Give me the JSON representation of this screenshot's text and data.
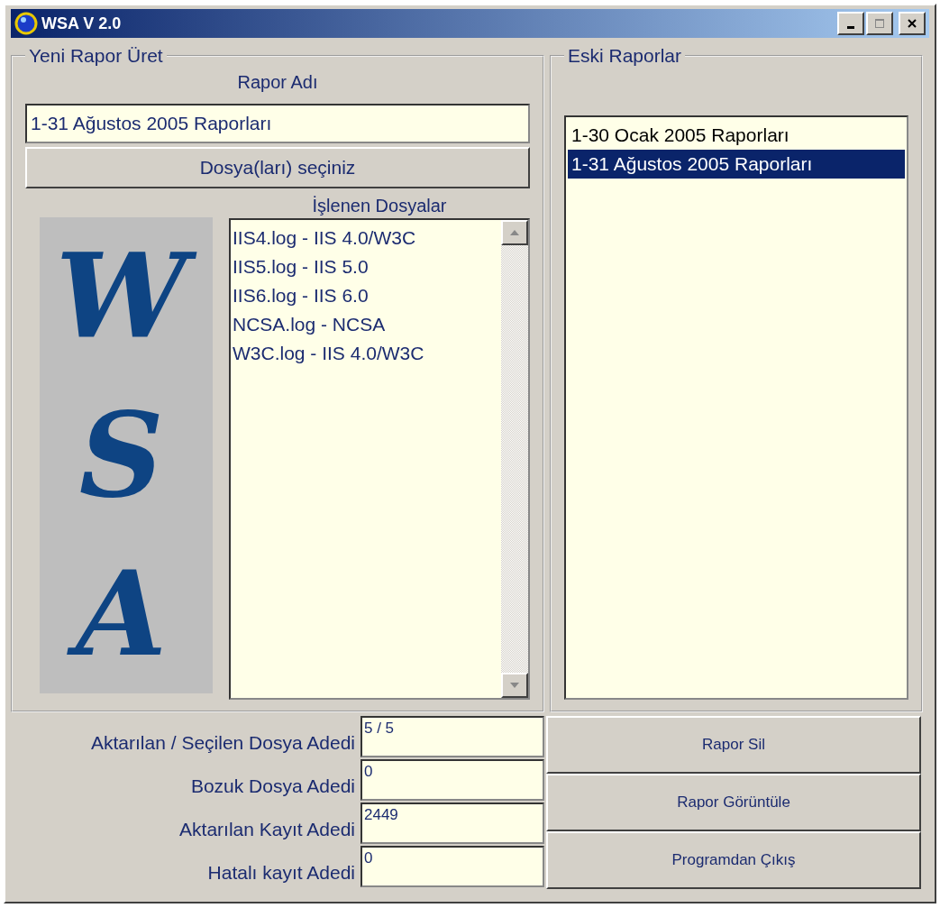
{
  "window": {
    "title": "WSA V 2.0"
  },
  "new_report": {
    "title": "Yeni Rapor Üret",
    "name_label": "Rapor Adı",
    "name_value": "1-31 Ağustos 2005 Raporları",
    "choose_button": "Dosya(ları) seçiniz",
    "files_label": "İşlenen Dosyalar",
    "logo_letters": [
      "W",
      "S",
      "A"
    ],
    "files": [
      "IIS4.log - IIS 4.0/W3C",
      "IIS5.log - IIS 5.0",
      "IIS6.log - IIS 6.0",
      "NCSA.log - NCSA",
      "W3C.log - IIS 4.0/W3C"
    ]
  },
  "old_reports": {
    "title": "Eski Raporlar",
    "items": [
      {
        "label": "1-30 Ocak 2005 Raporları",
        "selected": false
      },
      {
        "label": "1-31 Ağustos 2005 Raporları",
        "selected": true
      }
    ]
  },
  "stats": [
    {
      "label": "Aktarılan / Seçilen Dosya Adedi",
      "value": "5 / 5"
    },
    {
      "label": "Bozuk Dosya Adedi",
      "value": "0"
    },
    {
      "label": "Aktarılan Kayıt Adedi",
      "value": "2449"
    },
    {
      "label": "Hatalı kayıt Adedi",
      "value": "0"
    }
  ],
  "buttons": [
    "Rapor Sil",
    "Rapor Görüntüle",
    "Programdan Çıkış"
  ]
}
